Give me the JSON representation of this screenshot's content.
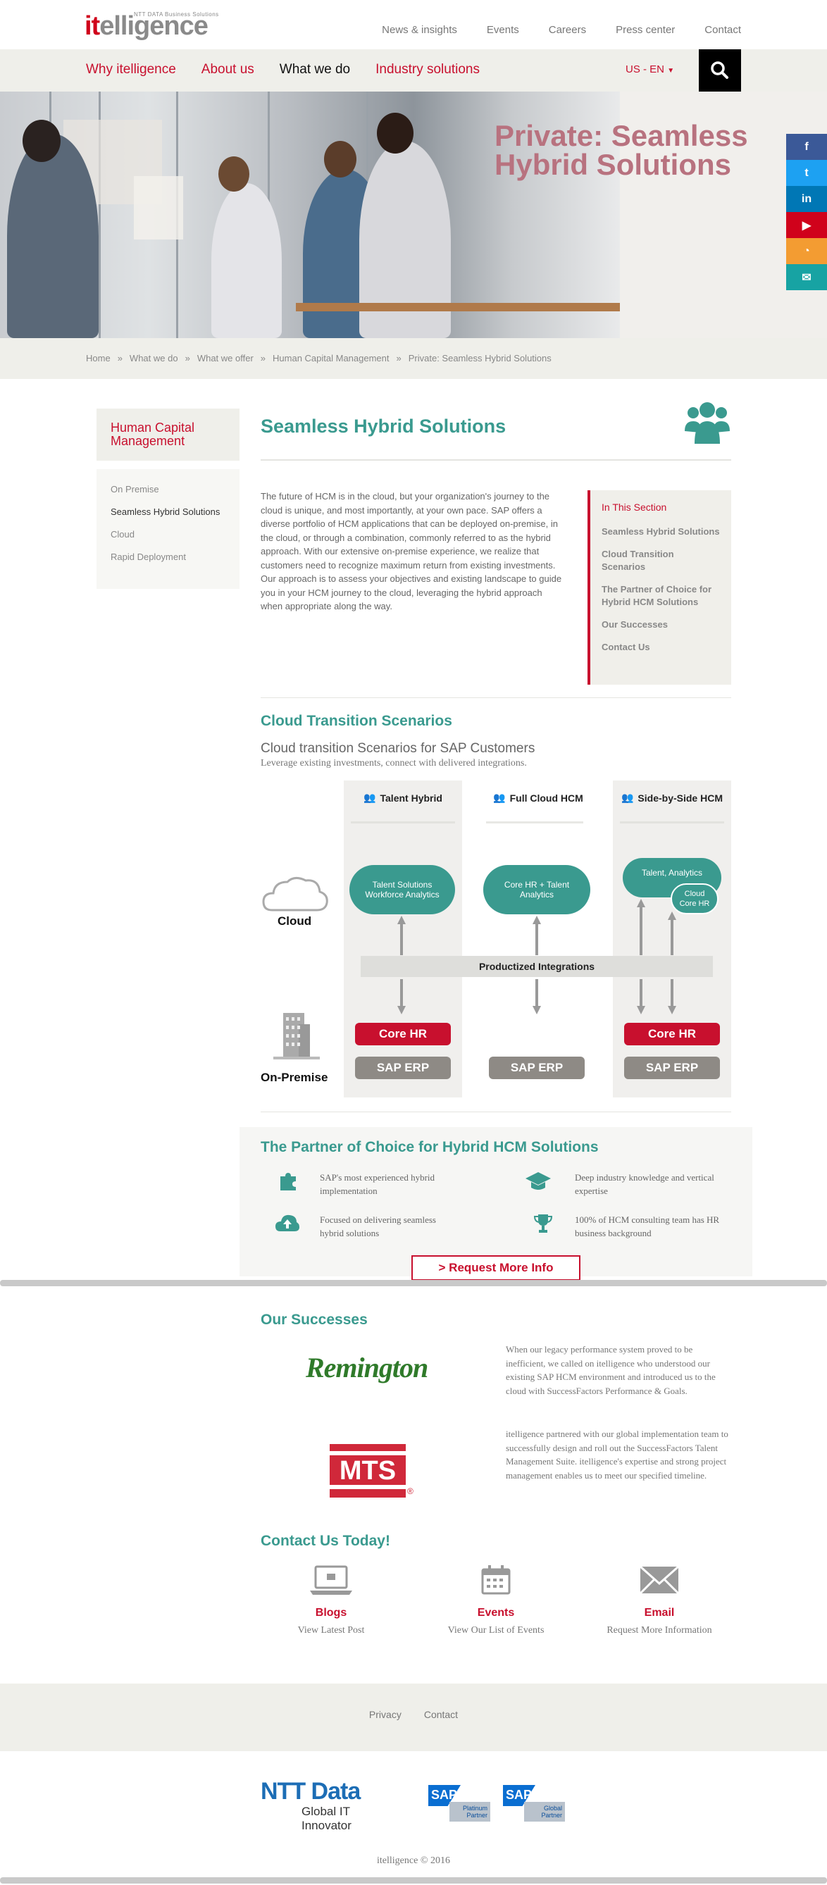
{
  "brand": {
    "logo_prefix": "it",
    "logo_rest": "elligence",
    "logo_tagline": "NTT DATA Business Solutions"
  },
  "top_nav": [
    "News & insights",
    "Events",
    "Careers",
    "Press center",
    "Contact"
  ],
  "main_nav": {
    "items": [
      {
        "label": "Why itelligence",
        "current": false
      },
      {
        "label": "About us",
        "current": false
      },
      {
        "label": "What we do",
        "current": true
      },
      {
        "label": "Industry solutions",
        "current": false
      }
    ],
    "language": "US - EN"
  },
  "hero": {
    "title": "Private: Seamless Hybrid Solutions"
  },
  "social": [
    {
      "icon": "facebook-icon",
      "glyph": "f",
      "color": "#3b5998"
    },
    {
      "icon": "twitter-icon",
      "glyph": "t",
      "color": "#1da1f2"
    },
    {
      "icon": "linkedin-icon",
      "glyph": "in",
      "color": "#0077b5"
    },
    {
      "icon": "youtube-icon",
      "glyph": "▶",
      "color": "#d0021b"
    },
    {
      "icon": "rss-icon",
      "glyph": "◔",
      "color": "#f39c32"
    },
    {
      "icon": "xing-icon",
      "glyph": "✉",
      "color": "#17a3a3"
    }
  ],
  "breadcrumb": [
    "Home",
    "What we do",
    "What we offer",
    "Human Capital Management",
    "Private: Seamless Hybrid Solutions"
  ],
  "sidebar": {
    "title": "Human Capital Management",
    "items": [
      {
        "label": "On Premise",
        "current": false
      },
      {
        "label": "Seamless Hybrid Solutions",
        "current": true
      },
      {
        "label": "Cloud",
        "current": false
      },
      {
        "label": "Rapid Deployment",
        "current": false
      }
    ]
  },
  "main": {
    "title": "Seamless Hybrid Solutions",
    "intro": "The future of HCM is in the cloud, but your organization's journey to the cloud is unique, and most importantly, at your own pace. SAP offers a diverse portfolio of HCM applications that can be deployed on-premise, in the cloud, or through a combination, commonly referred to as the hybrid approach. With our extensive on-premise experience, we realize that customers need to recognize maximum return from existing investments. Our approach is to assess your objectives and existing landscape to guide you in your HCM journey to the cloud, leveraging the hybrid approach when appropriate along the way."
  },
  "in_section": {
    "title": "In This Section",
    "items": [
      "Seamless Hybrid Solutions",
      "Cloud Transition Scenarios",
      "The Partner of Choice for Hybrid HCM Solutions",
      "Our Successes",
      "Contact Us"
    ]
  },
  "scenarios": {
    "title": "Cloud Transition Scenarios",
    "subtitle": "Cloud transition Scenarios for SAP Customers",
    "description": "Leverage existing investments, connect with delivered integrations.",
    "cloud_label": "Cloud",
    "onprem_label": "On-Premise",
    "integration_label": "Productized Integrations",
    "columns": [
      {
        "title": "Talent Hybrid",
        "cloud": "Talent Solutions Workforce Analytics",
        "core_hr": "Core HR",
        "erp": "SAP ERP"
      },
      {
        "title": "Full Cloud HCM",
        "cloud": "Core HR + Talent Analytics",
        "erp": "SAP ERP"
      },
      {
        "title": "Side-by-Side HCM",
        "cloud": "Talent, Analytics",
        "cloud2": "Cloud Core HR",
        "core_hr": "Core HR",
        "erp": "SAP ERP"
      }
    ]
  },
  "partner": {
    "title": "The Partner of Choice for Hybrid HCM Solutions",
    "features": [
      {
        "icon": "puzzle-icon",
        "text": "SAP's most experienced hybrid implementation"
      },
      {
        "icon": "graduation-cap-icon",
        "text": "Deep industry knowledge and vertical expertise"
      },
      {
        "icon": "cloud-upload-icon",
        "text": "Focused on delivering seamless hybrid solutions"
      },
      {
        "icon": "trophy-icon",
        "text": "100% of HCM consulting team has HR business background"
      }
    ],
    "cta": "> Request More Info"
  },
  "successes": {
    "title": "Our Successes",
    "items": [
      {
        "logo": "Remington",
        "quote": "When our legacy performance system proved to be inefficient, we called on itelligence who understood our existing SAP HCM environment and introduced us to the cloud with SuccessFactors Performance & Goals."
      },
      {
        "logo": "MTS",
        "quote": "itelligence partnered with our global implementation team to successfully design and roll out the SuccessFactors Talent Management Suite. itelligence's expertise and strong project management enables us to meet our specified timeline."
      }
    ]
  },
  "contact": {
    "title": "Contact Us Today!",
    "items": [
      {
        "icon": "laptop-icon",
        "label": "Blogs",
        "desc": "View Latest Post"
      },
      {
        "icon": "calendar-icon",
        "label": "Events",
        "desc": "View Our List of Events"
      },
      {
        "icon": "envelope-icon",
        "label": "Email",
        "desc": "Request More Information"
      }
    ]
  },
  "footer": {
    "links": [
      "Privacy",
      "Contact"
    ],
    "ntt_logo": "NTT Data",
    "ntt_tagline": "Global IT Innovator",
    "sap_badge1": "SAP",
    "sap_badge1_sub": "Platinum Partner",
    "sap_badge2": "SAP",
    "sap_badge2_sub": "Global Partner",
    "copyright": "itelligence © 2016"
  },
  "colors": {
    "brand_red": "#c8102e",
    "teal": "#3a9a8f",
    "light_bg": "#efefea"
  }
}
